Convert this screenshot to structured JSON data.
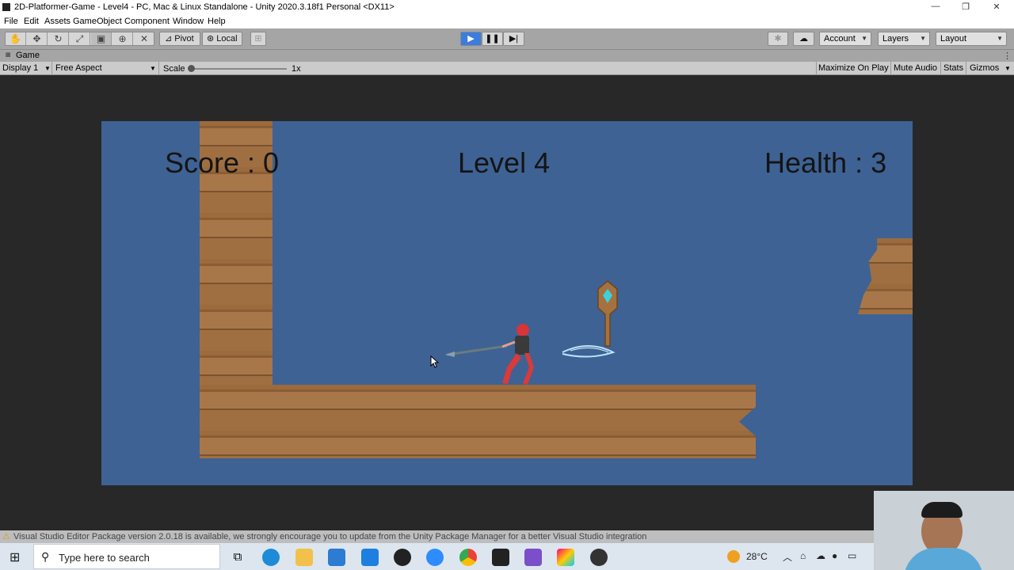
{
  "window": {
    "title": "2D-Platformer-Game - Level4 - PC, Mac & Linux Standalone - Unity 2020.3.18f1 Personal <DX11>",
    "minimize": "—",
    "restore": "❐",
    "close": "✕"
  },
  "menu": [
    "File",
    "Edit",
    "Assets",
    "GameObject",
    "Component",
    "Window",
    "Help"
  ],
  "toolbar": {
    "tools": [
      "hand-tool-icon",
      "move-tool-icon",
      "rotate-tool-icon",
      "scale-tool-icon",
      "rect-tool-icon",
      "transform-tool-icon",
      "custom-tool-icon"
    ],
    "pivot_label": "Pivot",
    "local_label": "Local",
    "account_label": "Account",
    "layers_label": "Layers",
    "layout_label": "Layout"
  },
  "game_tab": {
    "label": "Game"
  },
  "game_bar": {
    "display": "Display 1",
    "aspect": "Free Aspect",
    "scale_label": "Scale",
    "scale_value": "1x",
    "maximize": "Maximize On Play",
    "mute": "Mute Audio",
    "stats": "Stats",
    "gizmos": "Gizmos"
  },
  "hud": {
    "score": "Score : 0",
    "level": "Level 4",
    "health": "Health : 3"
  },
  "status": {
    "message": "Visual Studio Editor Package version 2.0.18 is available, we strongly encourage you to update from the Unity Package Manager for a better Visual Studio integration"
  },
  "taskbar": {
    "search_placeholder": "Type here to search",
    "weather": "28°C"
  },
  "colors": {
    "game_background": "#3e6294",
    "play_accent": "#3b7ddd",
    "wood": "#9b6b3e"
  }
}
